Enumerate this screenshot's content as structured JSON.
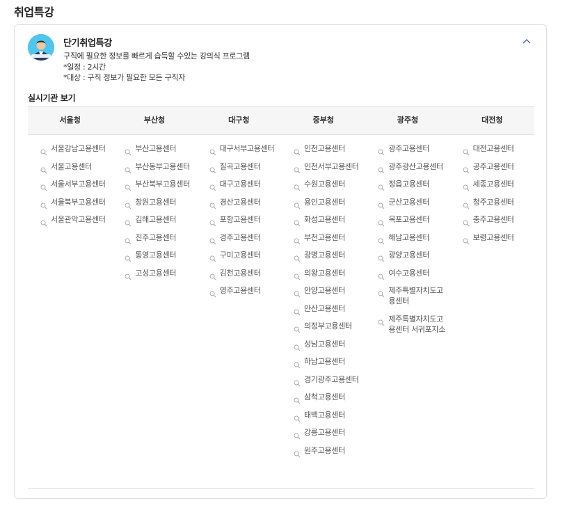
{
  "page": {
    "title": "취업특강"
  },
  "program": {
    "title": "단기취업특강",
    "description": "구직에 필요한 정보를 빠르게 습득할 수있는 강의식 프로그램",
    "schedule": "*일정 : 2시간",
    "target": "*대상 : 구직 정보가 필요한 모든 구직자"
  },
  "institutions": {
    "label": "실시기관 보기",
    "regions": [
      {
        "name": "서울청",
        "centers": [
          "서울강남고용센터",
          "서울고용센터",
          "서울서부고용센터",
          "서울북부고용센터",
          "서울관악고용센터"
        ]
      },
      {
        "name": "부산청",
        "centers": [
          "부산고용센터",
          "부산동부고용센터",
          "부산북부고용센터",
          "창원고용센터",
          "김해고용센터",
          "진주고용센터",
          "통영고용센터",
          "고성고용센터"
        ]
      },
      {
        "name": "대구청",
        "centers": [
          "대구서부고용센터",
          "칠곡고용센터",
          "대구고용센터",
          "경산고용센터",
          "포항고용센터",
          "경주고용센터",
          "구미고용센터",
          "김천고용센터",
          "영주고용센터"
        ]
      },
      {
        "name": "중부청",
        "centers": [
          "인천고용센터",
          "인천서부고용센터",
          "수원고용센터",
          "용인고용센터",
          "화성고용센터",
          "부천고용센터",
          "광명고용센터",
          "의왕고용센터",
          "안양고용센터",
          "안산고용센터",
          "의정부고용센터",
          "성남고용센터",
          "하남고용센터",
          "경기광주고용센터",
          "삼척고용센터",
          "태백고용센터",
          "강릉고용센터",
          "원주고용센터"
        ]
      },
      {
        "name": "광주청",
        "centers": [
          "광주고용센터",
          "광주광산고용센터",
          "정읍고용센터",
          "군산고용센터",
          "목포고용센터",
          "해남고용센터",
          "광양고용센터",
          "여수고용센터",
          "제주특별자치도고용센터",
          "제주특별자치도고용센터 서귀포지소"
        ]
      },
      {
        "name": "대전청",
        "centers": [
          "대전고용센터",
          "공주고용센터",
          "세종고용센터",
          "청주고용센터",
          "충주고용센터",
          "보령고용센터"
        ]
      }
    ]
  },
  "icons": {
    "collapse": "chevron-up-icon",
    "center": "search-icon"
  },
  "colors": {
    "avatar_bg": "#4fc6ee",
    "header_bg": "#f6f6f6",
    "chevron": "#3a5ab8"
  }
}
